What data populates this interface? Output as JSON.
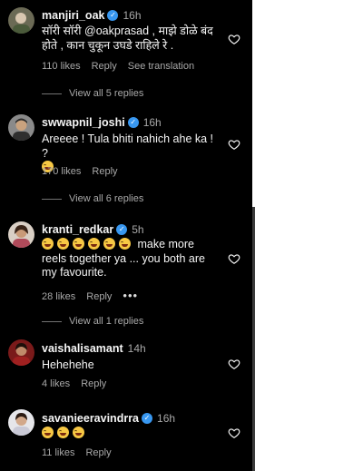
{
  "comments": [
    {
      "username": "manjiri_oak",
      "time": "16h",
      "text_lines": [
        "सॉरी सॉरी @oakprasad , माझे डोळे बंद",
        "होते , कान चुकून उघडे राहिले रे ."
      ],
      "likes": "110 likes",
      "reply": "Reply",
      "translate": "See translation",
      "view_replies": "View all 5 replies"
    },
    {
      "username": "swwapnil_joshi",
      "time": "16h",
      "text": "Areeee ! Tula bhiti nahich ahe ka ! ?",
      "likes": "170 likes",
      "reply": "Reply",
      "view_replies": "View all 6 replies"
    },
    {
      "username": "kranti_redkar",
      "time": "5h",
      "text_lines": [
        "make more",
        "reels together ya ... you both are",
        "my favourite."
      ],
      "likes": "28 likes",
      "reply": "Reply",
      "more": "•••",
      "view_replies": "View all 1 replies"
    },
    {
      "username": "vaishalisamant",
      "time": "14h",
      "text": "Hehehehe",
      "likes": "4 likes",
      "reply": "Reply"
    },
    {
      "username": "savanieeravindrra",
      "time": "16h",
      "likes": "11 likes",
      "reply": "Reply"
    }
  ],
  "icons": {
    "verified": "verified-badge-icon",
    "like": "heart-outline-icon",
    "emoji": "grinning-squinting-face-emoji"
  },
  "colors": {
    "background": "#000000",
    "verified": "#3897f0",
    "muted": "#a8a8a8"
  }
}
